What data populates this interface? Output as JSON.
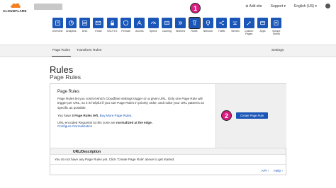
{
  "header": {
    "logo_text": "CLOUDFLARE",
    "add_site": "Add site",
    "support": "Support",
    "language": "English (US)"
  },
  "nav": [
    {
      "label": "Overview",
      "icon": "overview-icon"
    },
    {
      "label": "Analytics",
      "icon": "analytics-icon"
    },
    {
      "label": "DNS",
      "icon": "dns-icon"
    },
    {
      "label": "Email",
      "icon": "email-icon"
    },
    {
      "label": "SSL/TLS",
      "icon": "lock-icon"
    },
    {
      "label": "Firewall",
      "icon": "firewall-icon"
    },
    {
      "label": "Access",
      "icon": "access-icon"
    },
    {
      "label": "Speed",
      "icon": "speed-icon"
    },
    {
      "label": "Caching",
      "icon": "caching-icon"
    },
    {
      "label": "Workers",
      "icon": "workers-icon"
    },
    {
      "label": "Rules",
      "icon": "rules-icon"
    },
    {
      "label": "Network",
      "icon": "network-icon"
    },
    {
      "label": "Traffic",
      "icon": "traffic-icon"
    },
    {
      "label": "Stream",
      "icon": "stream-icon"
    },
    {
      "label": "Custom Pages",
      "icon": "custom-pages-icon"
    },
    {
      "label": "Apps",
      "icon": "apps-icon"
    },
    {
      "label": "Scrape Shield",
      "icon": "scrape-shield-icon"
    }
  ],
  "badges": {
    "one": "1",
    "two": "2"
  },
  "subtabs": {
    "page_rules": "Page Rules",
    "transform_rules": "Transform Rules",
    "settings": "Settings"
  },
  "page": {
    "title": "Rules",
    "subtitle": "Page Rules"
  },
  "card": {
    "title": "Page Rules",
    "description": "Page Rules let you control which Cloudflare settings trigger on a given URL. Only one Page Rule will trigger per URL, so it is helpful if you sort Page Rules in priority order, and make your URL patterns as specific as possible.",
    "rules_left_prefix": "You have ",
    "rules_left_count": "3 Page Rules left.",
    "buy_more": "Buy More Page Rules.",
    "normalized_prefix": "URL-encoded Requests to this zone are ",
    "normalized_bold": "normalized at the edge.",
    "configure": "Configure Normalization",
    "create_button": "Create Page Rule"
  },
  "table": {
    "header": "URL/Description",
    "empty": "You do not have any Page Rules yet. Click 'Create Page Rule' above to get started."
  },
  "footer_links": {
    "api": "API",
    "help": "Help"
  },
  "colors": {
    "accent": "#1a56b8",
    "badge": "#d91d82"
  }
}
